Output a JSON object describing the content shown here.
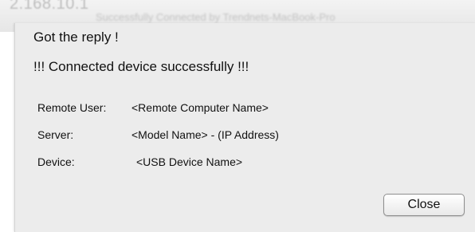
{
  "background": {
    "ip_text": "2.168.10.1",
    "status_text": "Successfully Connected by Trendnets-MacBook-Pro"
  },
  "dialog": {
    "line1": "Got the reply !",
    "line2": "!!! Connected device successfully !!!",
    "rows": [
      {
        "label": "Remote User:",
        "value": "<Remote Computer Name>"
      },
      {
        "label": "Server:",
        "value": "<Model Name> - (IP Address)"
      },
      {
        "label": "Device:",
        "value": "<USB Device Name>"
      }
    ],
    "close_label": "Close"
  }
}
